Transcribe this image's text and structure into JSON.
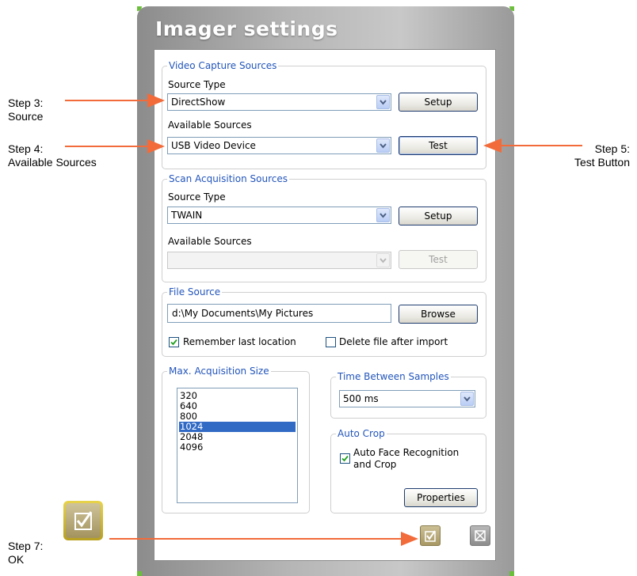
{
  "window": {
    "title": "Imager settings"
  },
  "video_capture": {
    "legend": "Video Capture Sources",
    "source_type_label": "Source Type",
    "source_type_value": "DirectShow",
    "setup_button": "Setup",
    "available_sources_label": "Available Sources",
    "available_sources_value": "USB Video Device",
    "test_button": "Test"
  },
  "scan_acquisition": {
    "legend": "Scan Acquisition Sources",
    "source_type_label": "Source Type",
    "source_type_value": "TWAIN",
    "setup_button": "Setup",
    "available_sources_label": "Available Sources",
    "available_sources_value": "",
    "test_button": "Test"
  },
  "file_source": {
    "legend": "File Source",
    "path_value": "d:\\My Documents\\My Pictures",
    "browse_button": "Browse",
    "remember_label": "Remember last location",
    "remember_checked": true,
    "delete_label": "Delete file after import",
    "delete_checked": false
  },
  "max_acquisition": {
    "legend": "Max. Acquisition Size",
    "options": [
      "320",
      "640",
      "800",
      "1024",
      "2048",
      "4096"
    ],
    "selected": "1024"
  },
  "time_between": {
    "legend": "Time Between Samples",
    "value": "500 ms"
  },
  "auto_crop": {
    "legend": "Auto Crop",
    "checkbox_label_line1": "Auto Face Recognition",
    "checkbox_label_line2": "and Crop",
    "checked": true,
    "properties_button": "Properties"
  },
  "footer": {
    "ok_icon": "check-icon",
    "cancel_icon": "cancel-icon"
  },
  "annotations": {
    "step3_line1": "Step 3:",
    "step3_line2": "Source",
    "step4_line1": "Step 4:",
    "step4_line2": "Available Sources",
    "step5_line1": "Step 5:",
    "step5_line2": "Test Button",
    "step7_line1": "Step 7:",
    "step7_line2": "OK"
  },
  "colors": {
    "arrow": "#f26b3a",
    "legend_text": "#2255bb",
    "selection": "#316ac5",
    "window_accent": "#6cbf3a"
  }
}
